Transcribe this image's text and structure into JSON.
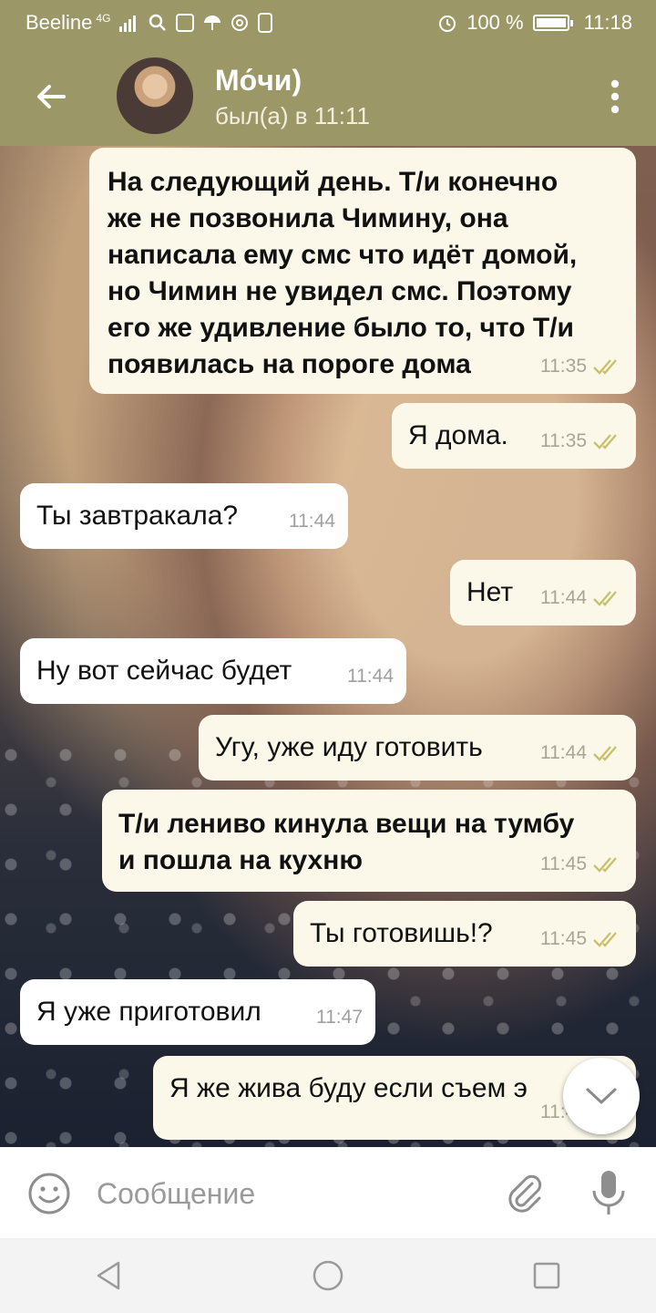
{
  "status_bar": {
    "carrier": "Beeline",
    "network": "4G",
    "battery": "100 %",
    "time": "11:18"
  },
  "header": {
    "title": "Мо́чи)",
    "subtitle": "был(а) в 11:11"
  },
  "messages": [
    {
      "direction": "out",
      "text": "На следующий день. Т/и конечно\nже не позвонила Чимину, она\nнаписала ему смс что идёт домой,\nно Чимин не увидел смс. Поэтому\nего же удивление было то, что Т/и\nпоявилась на пороге дома",
      "time": "11:35",
      "read": true
    },
    {
      "direction": "out",
      "text": "Я дома.",
      "time": "11:35",
      "read": true
    },
    {
      "direction": "in",
      "text": "Ты завтракала?",
      "time": "11:44"
    },
    {
      "direction": "out",
      "text": "Нет",
      "time": "11:44",
      "read": true
    },
    {
      "direction": "in",
      "text": "Ну вот сейчас будет",
      "time": "11:44"
    },
    {
      "direction": "out",
      "text": "Угу, уже иду готовить",
      "time": "11:44",
      "read": true
    },
    {
      "direction": "out",
      "text": "Т/и лениво кинула вещи на тумбу\nи пошла на кухню",
      "time": "11:45",
      "read": true
    },
    {
      "direction": "out",
      "text": "Ты готовишь!?",
      "time": "11:45",
      "read": true
    },
    {
      "direction": "in",
      "text": "Я уже приготовил",
      "time": "11:47"
    },
    {
      "direction": "out",
      "text": "Я же жива буду если съем э",
      "time": "11:48",
      "read": true
    }
  ],
  "composer": {
    "placeholder": "Сообщение"
  },
  "colors": {
    "header": "#9c9766",
    "outgoing_bubble": "#fbf8e9",
    "incoming_bubble": "#ffffff",
    "read_ticks": "#c9c06b"
  },
  "icons": {
    "back": "arrow-left-icon",
    "menu": "more-vert-icon",
    "emoji": "smile-icon",
    "attach": "paperclip-icon",
    "mic": "microphone-icon",
    "scroll": "chevron-down-icon",
    "nav": [
      "back-triangle-icon",
      "home-circle-icon",
      "recents-square-icon"
    ]
  }
}
